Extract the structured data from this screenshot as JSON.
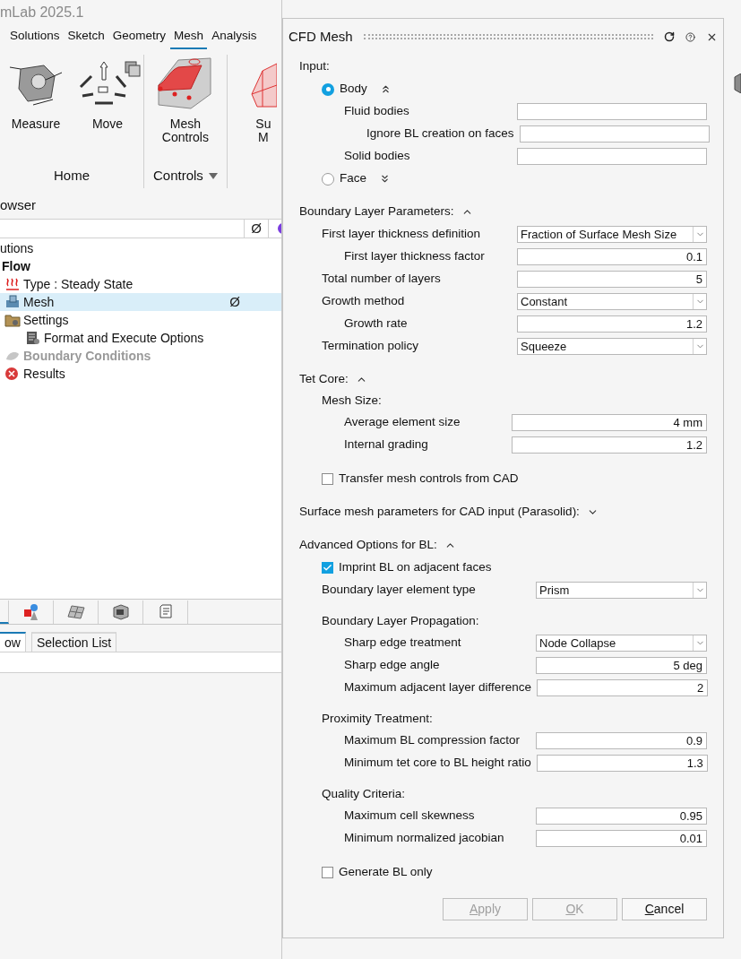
{
  "app_title": "mLab 2025.1",
  "ribbon_tabs": [
    {
      "label": "Solutions",
      "selected": false
    },
    {
      "label": "Sketch",
      "selected": false
    },
    {
      "label": "Geometry",
      "selected": false
    },
    {
      "label": "Mesh",
      "selected": true
    },
    {
      "label": "Analysis",
      "selected": false
    }
  ],
  "ribbon_groups": [
    {
      "label": "Home",
      "dropdown": false,
      "tools": [
        {
          "kind": "measure",
          "lines": [
            "Measure"
          ]
        },
        {
          "kind": "move",
          "lines": [
            "Move"
          ]
        }
      ]
    },
    {
      "label": "Controls",
      "dropdown": true,
      "tools": [
        {
          "kind": "mesh-controls",
          "lines": [
            "Mesh",
            "Controls"
          ]
        }
      ]
    },
    {
      "tools": [
        {
          "kind": "surface-mesh",
          "lines": [
            "Su",
            "M"
          ]
        }
      ]
    }
  ],
  "browser": {
    "title": "owser",
    "column_symbol": "Ø",
    "tree": [
      {
        "label": "utions",
        "bold": false,
        "disabled": false,
        "selected": false,
        "children": [
          {
            "label": "Flow",
            "bold": true,
            "disabled": false,
            "selected": false,
            "children": [
              {
                "kind": "heat",
                "label": "Type : Steady State",
                "bold": false,
                "disabled": false,
                "selected": false
              },
              {
                "kind": "mesh",
                "label": "Mesh",
                "bold": false,
                "disabled": false,
                "selected": true,
                "symbol": "Ø"
              },
              {
                "kind": "folder",
                "label": "Settings",
                "bold": false,
                "disabled": false,
                "selected": false,
                "children": [
                  {
                    "kind": "document",
                    "label": "Format and Execute Options",
                    "bold": false,
                    "disabled": false,
                    "selected": false
                  }
                ]
              },
              {
                "kind": "boundary",
                "label": "Boundary Conditions",
                "bold": true,
                "disabled": true,
                "selected": false
              },
              {
                "kind": "error",
                "label": "Results",
                "bold": false,
                "disabled": false,
                "selected": false
              }
            ]
          }
        ]
      }
    ]
  },
  "icon_tabs": [
    {
      "kind": "blank",
      "selected": true
    },
    {
      "kind": "shapes",
      "selected": false
    },
    {
      "kind": "surface",
      "selected": false
    },
    {
      "kind": "cube",
      "selected": false
    },
    {
      "kind": "script",
      "selected": false
    }
  ],
  "panel_tabs": [
    {
      "label": "ow",
      "selected": true
    },
    {
      "label": "Selection List",
      "selected": false
    }
  ],
  "dialog": {
    "title": "CFD Mesh",
    "sections": [
      {
        "title": "Input:",
        "rows": [
          {
            "kind": "radio",
            "label": "Body",
            "selected": true,
            "expanded": true,
            "children": [
              {
                "kind": "field",
                "label": "Fluid bodies",
                "children": [
                  {
                    "kind": "field",
                    "label": "Ignore BL creation on faces"
                  }
                ]
              },
              {
                "kind": "field",
                "label": "Solid bodies"
              }
            ]
          },
          {
            "kind": "radio",
            "label": "Face",
            "selected": false,
            "expanded": false
          }
        ]
      },
      {
        "title": "Boundary Layer Parameters:",
        "expanded": true,
        "rows": [
          {
            "kind": "select",
            "label": "First layer thickness definition",
            "value": "Fraction of Surface Mesh Size",
            "children": [
              {
                "kind": "field",
                "label": "First layer thickness factor",
                "value": "0.1"
              }
            ]
          },
          {
            "kind": "field",
            "label": "Total number of layers",
            "value": "5"
          },
          {
            "kind": "select",
            "label": "Growth method",
            "value": "Constant",
            "children": [
              {
                "kind": "field",
                "label": "Growth rate",
                "value": "1.2"
              }
            ]
          },
          {
            "kind": "select",
            "label": "Termination policy",
            "value": "Squeeze"
          }
        ]
      },
      {
        "title": "Tet Core:",
        "expanded": true,
        "rows": [
          {
            "kind": "heading",
            "label": "Mesh Size:",
            "children": [
              {
                "kind": "field",
                "label": "Average element size",
                "value": "4 mm"
              },
              {
                "kind": "field",
                "label": "Internal grading",
                "value": "1.2"
              }
            ]
          },
          {
            "kind": "checkbox",
            "label": "Transfer mesh controls from CAD",
            "checked": false
          }
        ]
      },
      {
        "title": "Surface mesh parameters for CAD input (Parasolid):",
        "expanded": false
      },
      {
        "title": "Advanced Options for BL:",
        "expanded": true,
        "rows": [
          {
            "kind": "checkbox",
            "label": "Imprint BL on adjacent faces",
            "checked": true
          },
          {
            "kind": "select",
            "label": "Boundary layer element type",
            "value": "Prism"
          },
          {
            "kind": "heading",
            "label": "Boundary Layer Propagation:",
            "children": [
              {
                "kind": "select",
                "label": "Sharp edge treatment",
                "value": "Node Collapse"
              },
              {
                "kind": "field",
                "label": "Sharp edge angle",
                "value": "5 deg"
              },
              {
                "kind": "field",
                "label": "Maximum adjacent layer difference",
                "value": "2"
              }
            ]
          },
          {
            "kind": "heading",
            "label": "Proximity Treatment:",
            "children": [
              {
                "kind": "field",
                "label": "Maximum BL compression factor",
                "value": "0.9"
              },
              {
                "kind": "field",
                "label": "Minimum tet core to BL height ratio",
                "value": "1.3"
              }
            ]
          },
          {
            "kind": "heading",
            "label": "Quality Criteria:",
            "children": [
              {
                "kind": "field",
                "label": "Maximum cell skewness",
                "value": "0.95"
              },
              {
                "kind": "field",
                "label": "Minimum normalized jacobian",
                "value": "0.01"
              }
            ]
          },
          {
            "kind": "checkbox",
            "label": "Generate BL only",
            "checked": false
          }
        ]
      }
    ],
    "buttons": [
      {
        "label": "Apply",
        "disabled": true
      },
      {
        "label": "OK",
        "disabled": true
      },
      {
        "label": "Cancel",
        "disabled": false
      }
    ]
  }
}
